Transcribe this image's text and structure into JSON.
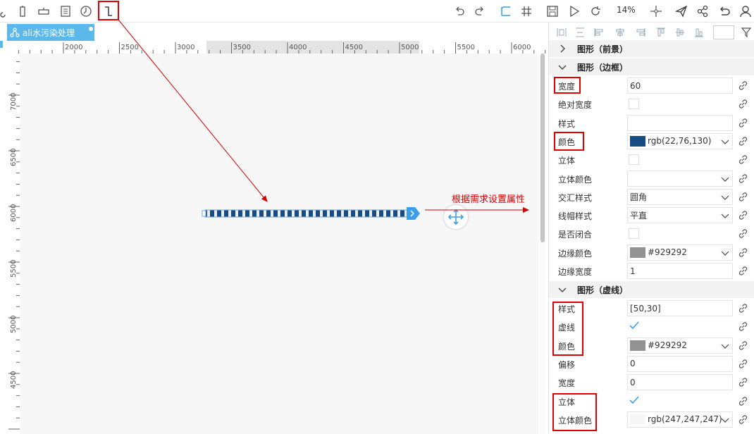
{
  "toolbar": {
    "zoom_label": "14%",
    "left_tools": [
      "brush-icon",
      "column-icon",
      "row-icon",
      "document-icon",
      "clock-icon",
      "connector-icon"
    ],
    "right_tools": [
      "undo-icon",
      "redo-icon",
      "frame-icon",
      "grid-icon",
      "save-icon",
      "play-icon",
      "refresh-icon",
      "zoom-label",
      "move-icon",
      "send-icon",
      "share-icon",
      "back-icon",
      "user-icon"
    ]
  },
  "tab": {
    "label": "ali水污染处理",
    "icon": "hierarchy-icon"
  },
  "ruler": {
    "h_ticks": [
      "2000",
      "2500",
      "3000",
      "3500",
      "4000",
      "4500",
      "5000",
      "5500",
      "6000"
    ],
    "v_ticks": [
      "7000",
      "6500",
      "6000",
      "5500",
      "5000",
      "4500"
    ]
  },
  "annotation": {
    "text": "根据需求设置属性",
    "color": "#d40000"
  },
  "pipe": {
    "color": "#16 4c82",
    "dash": "[50,30]"
  },
  "panel": {
    "sections": [
      {
        "title": "图形（前景）",
        "expanded": false
      },
      {
        "title": "图形（边框）",
        "expanded": true
      },
      {
        "title": "图形（虚线）",
        "expanded": true
      }
    ],
    "border_rows": [
      {
        "label": "宽度",
        "type": "text",
        "value": "60"
      },
      {
        "label": "绝对宽度",
        "type": "checkbox",
        "checked": false
      },
      {
        "label": "样式",
        "type": "text",
        "value": ""
      },
      {
        "label": "颜色",
        "type": "color",
        "value": "rgb(22,76,130)",
        "swatch": "#164c82"
      },
      {
        "label": "立体",
        "type": "checkbox",
        "checked": false
      },
      {
        "label": "立体颜色",
        "type": "select",
        "value": ""
      },
      {
        "label": "交汇样式",
        "type": "select",
        "value": "圆角"
      },
      {
        "label": "线帽样式",
        "type": "select",
        "value": "平直"
      },
      {
        "label": "是否闭合",
        "type": "checkbox",
        "checked": false
      },
      {
        "label": "边缘颜色",
        "type": "color",
        "value": "#929292",
        "swatch": "#929292"
      },
      {
        "label": "边缘宽度",
        "type": "text",
        "value": "1"
      }
    ],
    "dash_rows": [
      {
        "label": "样式",
        "type": "text",
        "value": "[50,30]"
      },
      {
        "label": "虚线",
        "type": "checkbox",
        "checked": true
      },
      {
        "label": "颜色",
        "type": "color",
        "value": "#929292",
        "swatch": "#929292"
      },
      {
        "label": "偏移",
        "type": "text",
        "value": "0"
      },
      {
        "label": "宽度",
        "type": "text",
        "value": "0"
      },
      {
        "label": "立体",
        "type": "checkbox",
        "checked": true
      },
      {
        "label": "立体颜色",
        "type": "color",
        "value": "rgb(247,247,247)",
        "swatch": "#f7f7f7"
      }
    ]
  },
  "colors": {
    "accent": "#5cb8ea",
    "highlight": "#e00000",
    "check": "#3a9ee8"
  }
}
